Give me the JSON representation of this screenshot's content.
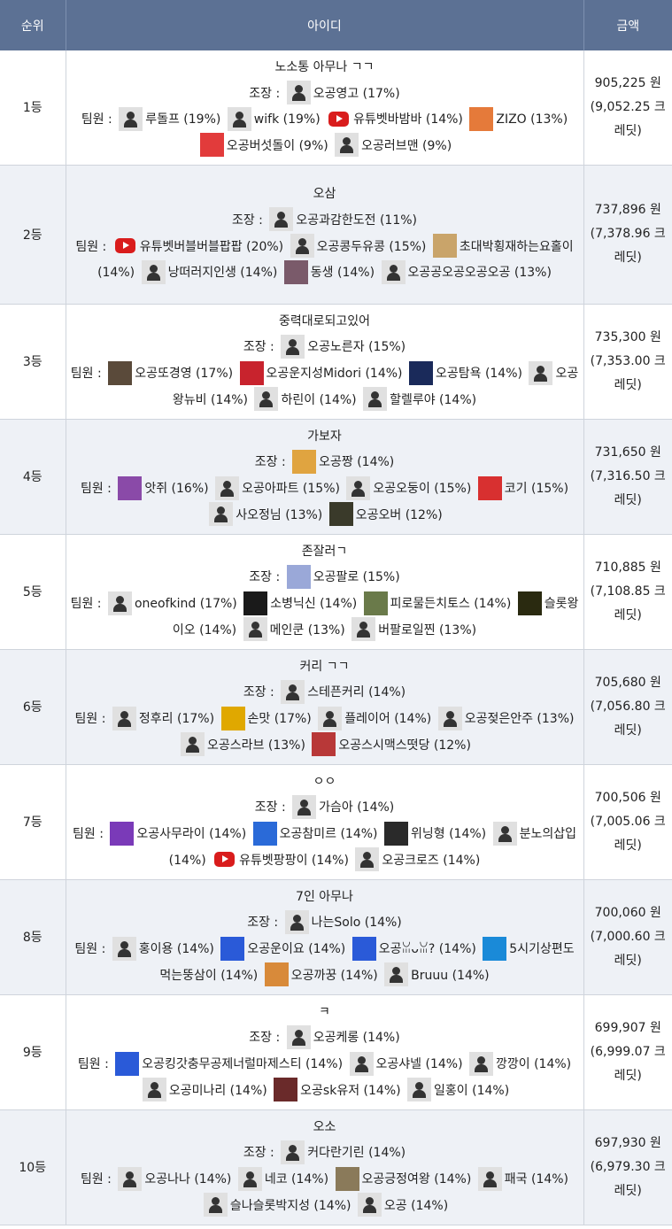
{
  "header": {
    "rank": "순위",
    "id": "아이디",
    "amount": "금액"
  },
  "rows": [
    {
      "rank": "1등",
      "team": "노소통 아무나 ㄱㄱ",
      "leader_label": "조장 :",
      "members_label": "팀원 :",
      "leader": {
        "name": "오공영고 (17%)",
        "avatar": "default"
      },
      "members": [
        {
          "name": "루돌프 (19%)",
          "avatar": "default"
        },
        {
          "name": "wifk (19%)",
          "avatar": "default"
        },
        {
          "name": "유튜벳바밤바 (14%)",
          "avatar": "youtube"
        },
        {
          "name": "ZIZO (13%)",
          "avatar": "image",
          "color": "#e57a3a"
        },
        {
          "name": "오공버섯돌이 (9%)",
          "avatar": "image",
          "color": "#e23b3b"
        },
        {
          "name": "오공러브맨 (9%)",
          "avatar": "default"
        }
      ],
      "amount": {
        "won": "905,225 원",
        "credit": "(9,052.25 크레딧)"
      }
    },
    {
      "rank": "2등",
      "team": "오삼",
      "leader_label": "조장 :",
      "members_label": "팀원 :",
      "leader": {
        "name": "오공과감한도전 (11%)",
        "avatar": "default"
      },
      "members": [
        {
          "name": "유튜벳버블버블팝팝 (20%)",
          "avatar": "youtube"
        },
        {
          "name": "오공콩두유콩 (15%)",
          "avatar": "default"
        },
        {
          "name": "초대박횡재하는요홀이 (14%)",
          "avatar": "image",
          "color": "#c9a46a"
        },
        {
          "name": "낭떠러지인생 (14%)",
          "avatar": "default"
        },
        {
          "name": "동생 (14%)",
          "avatar": "image",
          "color": "#7a5a6a"
        },
        {
          "name": "오공공오공오공오공 (13%)",
          "avatar": "default"
        }
      ],
      "amount": {
        "won": "737,896 원",
        "credit": "(7,378.96 크레딧)"
      }
    },
    {
      "rank": "3등",
      "team": "중력대로되고있어",
      "leader_label": "조장 :",
      "members_label": "팀원 :",
      "leader": {
        "name": "오공노른자 (15%)",
        "avatar": "default"
      },
      "members": [
        {
          "name": "오공또경영 (17%)",
          "avatar": "image",
          "color": "#5a4a3a"
        },
        {
          "name": "오공운지성Midori (14%)",
          "avatar": "image",
          "color": "#c8232d"
        },
        {
          "name": "오공탐욕 (14%)",
          "avatar": "image",
          "color": "#1a2a5a"
        },
        {
          "name": "오공왕뉴비 (14%)",
          "avatar": "default"
        },
        {
          "name": "하린이 (14%)",
          "avatar": "default"
        },
        {
          "name": "할렐루야 (14%)",
          "avatar": "default"
        }
      ],
      "amount": {
        "won": "735,300 원",
        "credit": "(7,353.00 크레딧)"
      }
    },
    {
      "rank": "4등",
      "team": "가보자",
      "leader_label": "조장 :",
      "members_label": "팀원 :",
      "leader": {
        "name": "오공짱 (14%)",
        "avatar": "image",
        "color": "#e0a440"
      },
      "members": [
        {
          "name": "앗쥐 (16%)",
          "avatar": "image",
          "color": "#8a4aa8"
        },
        {
          "name": "오공아파트 (15%)",
          "avatar": "default"
        },
        {
          "name": "오공오둥이 (15%)",
          "avatar": "default"
        },
        {
          "name": "코기 (15%)",
          "avatar": "image",
          "color": "#d83030"
        },
        {
          "name": "사오정님 (13%)",
          "avatar": "default"
        },
        {
          "name": "오공오버 (12%)",
          "avatar": "image",
          "color": "#3a3a2a"
        }
      ],
      "amount": {
        "won": "731,650 원",
        "credit": "(7,316.50 크레딧)"
      }
    },
    {
      "rank": "5등",
      "team": "존잘러ㄱ",
      "leader_label": "조장 :",
      "members_label": "팀원 :",
      "leader": {
        "name": "오공팔로 (15%)",
        "avatar": "image",
        "color": "#9aa8d8"
      },
      "members": [
        {
          "name": "oneofkind (17%)",
          "avatar": "default"
        },
        {
          "name": "소병닉신 (14%)",
          "avatar": "image",
          "color": "#1a1a1a"
        },
        {
          "name": "피로물든치토스 (14%)",
          "avatar": "image",
          "color": "#6a7a4a"
        },
        {
          "name": "슬롯왕이오 (14%)",
          "avatar": "image",
          "color": "#2a2a10"
        },
        {
          "name": "메인쿤 (13%)",
          "avatar": "default"
        },
        {
          "name": "버팔로일찐 (13%)",
          "avatar": "default"
        }
      ],
      "amount": {
        "won": "710,885 원",
        "credit": "(7,108.85 크레딧)"
      }
    },
    {
      "rank": "6등",
      "team": "커리 ㄱㄱ",
      "leader_label": "조장 :",
      "members_label": "팀원 :",
      "leader": {
        "name": "스테픈커리 (14%)",
        "avatar": "default"
      },
      "members": [
        {
          "name": "정후리 (17%)",
          "avatar": "default"
        },
        {
          "name": "손맛 (17%)",
          "avatar": "image",
          "color": "#e0a800"
        },
        {
          "name": "플레이어 (14%)",
          "avatar": "default"
        },
        {
          "name": "오공젖은안주 (13%)",
          "avatar": "default"
        },
        {
          "name": "오공스라브 (13%)",
          "avatar": "default"
        },
        {
          "name": "오공스시맥스떳당 (12%)",
          "avatar": "image",
          "color": "#b83838"
        }
      ],
      "amount": {
        "won": "705,680 원",
        "credit": "(7,056.80 크레딧)"
      }
    },
    {
      "rank": "7등",
      "team": "ㅇㅇ",
      "leader_label": "조장 :",
      "members_label": "팀원 :",
      "leader": {
        "name": "가슴아 (14%)",
        "avatar": "default"
      },
      "members": [
        {
          "name": "오공사무라이 (14%)",
          "avatar": "image",
          "color": "#7a3ab8"
        },
        {
          "name": "오공참미르 (14%)",
          "avatar": "image",
          "color": "#2a6ad8"
        },
        {
          "name": "위닝형 (14%)",
          "avatar": "image",
          "color": "#2a2a2a"
        },
        {
          "name": "분노의삽입 (14%)",
          "avatar": "default"
        },
        {
          "name": "유튜벳팡팡이 (14%)",
          "avatar": "youtube"
        },
        {
          "name": "오공크로즈 (14%)",
          "avatar": "default"
        }
      ],
      "amount": {
        "won": "700,506 원",
        "credit": "(7,005.06 크레딧)"
      }
    },
    {
      "rank": "8등",
      "team": "7인 아무나",
      "leader_label": "조장 :",
      "members_label": "팀원 :",
      "leader": {
        "name": "나는Solo (14%)",
        "avatar": "default"
      },
      "members": [
        {
          "name": "홍이용 (14%)",
          "avatar": "default"
        },
        {
          "name": "오공운이요 (14%)",
          "avatar": "image",
          "color": "#2a5ad8"
        },
        {
          "name": "오공ꈍᴗꈍ? (14%)",
          "avatar": "image",
          "color": "#2a5ad8"
        },
        {
          "name": "5시기상편도먹는뚱삼이 (14%)",
          "avatar": "image",
          "color": "#1a8ad8"
        },
        {
          "name": "오공까꿍 (14%)",
          "avatar": "image",
          "color": "#d88a3a"
        },
        {
          "name": "Bruuu (14%)",
          "avatar": "default"
        }
      ],
      "amount": {
        "won": "700,060 원",
        "credit": "(7,000.60 크레딧)"
      }
    },
    {
      "rank": "9등",
      "team": "ㅋ",
      "leader_label": "조장 :",
      "members_label": "팀원 :",
      "leader": {
        "name": "오공케롱 (14%)",
        "avatar": "default"
      },
      "members": [
        {
          "name": "오공킹갓충무공제너럴마제스티 (14%)",
          "avatar": "image",
          "color": "#2a5ad8"
        },
        {
          "name": "오공샤넬 (14%)",
          "avatar": "default"
        },
        {
          "name": "깡깡이 (14%)",
          "avatar": "default"
        },
        {
          "name": "오공미나리 (14%)",
          "avatar": "default"
        },
        {
          "name": "오공sk유저 (14%)",
          "avatar": "image",
          "color": "#6a2a2a"
        },
        {
          "name": "일홍이 (14%)",
          "avatar": "default"
        }
      ],
      "amount": {
        "won": "699,907 원",
        "credit": "(6,999.07 크레딧)"
      }
    },
    {
      "rank": "10등",
      "team": "오소",
      "leader_label": "조장 :",
      "members_label": "팀원 :",
      "leader": {
        "name": "커다란기린 (14%)",
        "avatar": "default"
      },
      "members": [
        {
          "name": "오공나나 (14%)",
          "avatar": "default"
        },
        {
          "name": "네코 (14%)",
          "avatar": "default"
        },
        {
          "name": "오공긍정여왕 (14%)",
          "avatar": "image",
          "color": "#8a7a5a"
        },
        {
          "name": "패국 (14%)",
          "avatar": "default"
        },
        {
          "name": "슬나슬롯박지성 (14%)",
          "avatar": "default"
        },
        {
          "name": "오공 (14%)",
          "avatar": "default"
        }
      ],
      "amount": {
        "won": "697,930 원",
        "credit": "(6,979.30 크레딧)"
      }
    }
  ]
}
